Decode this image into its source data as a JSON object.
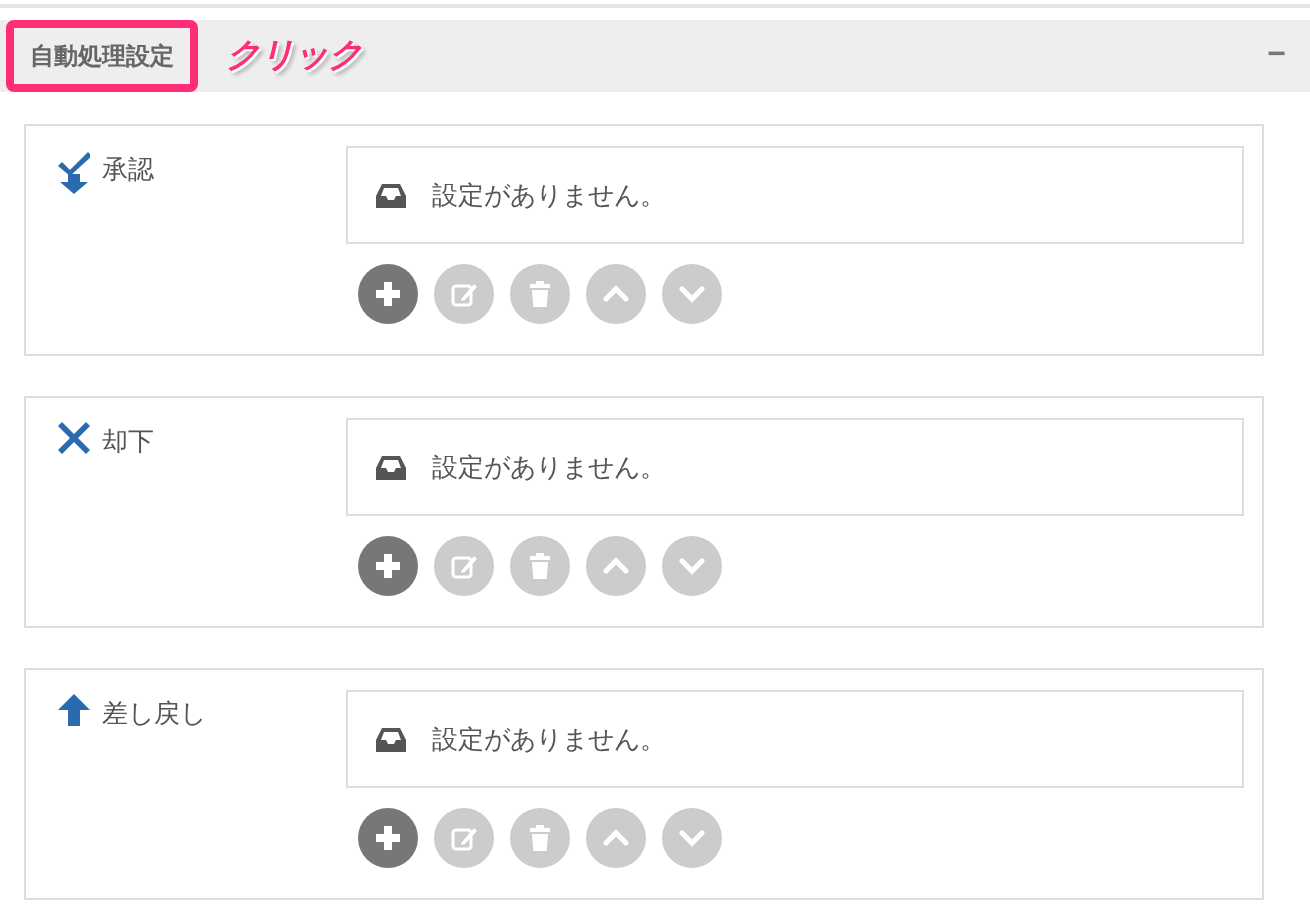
{
  "header": {
    "title": "自動処理設定",
    "highlighted": true,
    "annotation": "クリック",
    "collapse_symbol": "−"
  },
  "sections": [
    {
      "kind": "approve",
      "label": "承認",
      "message": "設定がありません。",
      "buttons": [
        {
          "kind": "add",
          "disabled": false
        },
        {
          "kind": "edit",
          "disabled": true
        },
        {
          "kind": "delete",
          "disabled": true
        },
        {
          "kind": "up",
          "disabled": true
        },
        {
          "kind": "down",
          "disabled": true
        }
      ]
    },
    {
      "kind": "reject",
      "label": "却下",
      "message": "設定がありません。",
      "buttons": [
        {
          "kind": "add",
          "disabled": false
        },
        {
          "kind": "edit",
          "disabled": true
        },
        {
          "kind": "delete",
          "disabled": true
        },
        {
          "kind": "up",
          "disabled": true
        },
        {
          "kind": "down",
          "disabled": true
        }
      ]
    },
    {
      "kind": "return",
      "label": "差し戻し",
      "message": "設定がありません。",
      "buttons": [
        {
          "kind": "add",
          "disabled": false
        },
        {
          "kind": "edit",
          "disabled": true
        },
        {
          "kind": "delete",
          "disabled": true
        },
        {
          "kind": "up",
          "disabled": true
        },
        {
          "kind": "down",
          "disabled": true
        }
      ]
    }
  ]
}
